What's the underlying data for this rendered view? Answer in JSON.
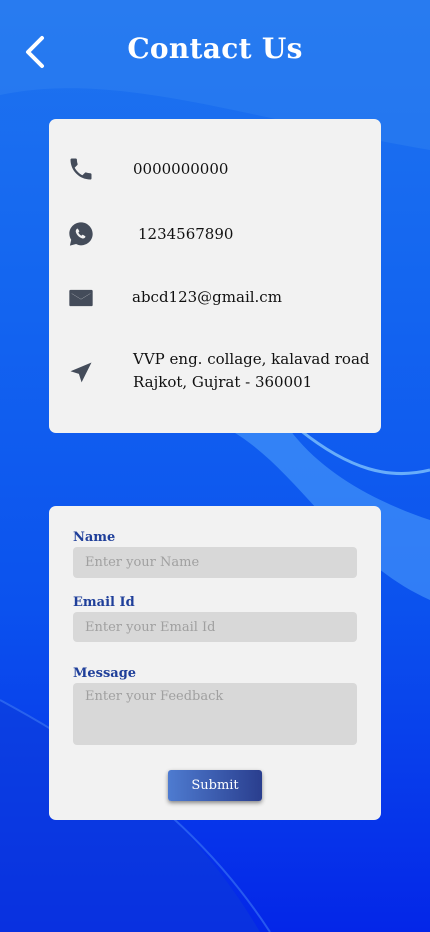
{
  "header": {
    "title": "Contact Us",
    "back_icon": "chevron-left-icon"
  },
  "contact_info": {
    "phone": {
      "icon": "phone-icon",
      "value": "0000000000"
    },
    "whatsapp": {
      "icon": "whatsapp-icon",
      "value": "1234567890"
    },
    "email": {
      "icon": "mail-icon",
      "value": "abcd123@gmail.cm"
    },
    "address": {
      "icon": "location-arrow-icon",
      "line1": "VVP eng. collage, kalavad road",
      "line2": "Rajkot, Gujrat - 360001"
    }
  },
  "form": {
    "name_label": "Name",
    "name_placeholder": "Enter your Name",
    "email_label": "Email Id",
    "email_placeholder": "Enter your Email Id",
    "message_label": "Message",
    "message_placeholder": "Enter your Feedback",
    "submit_label": "Submit"
  },
  "colors": {
    "background_top": "#1f74ef",
    "background_bottom": "#0426e8",
    "card": "#f2f2f2",
    "label": "#1f3f9a",
    "icon": "#444c5a",
    "field": "#d8d8d8"
  }
}
